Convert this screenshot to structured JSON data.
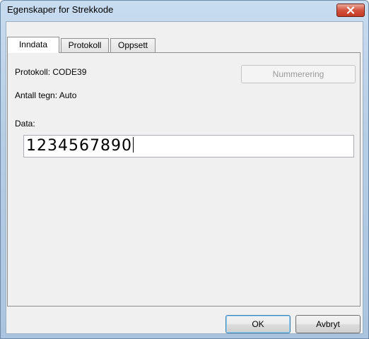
{
  "window": {
    "title": "Egenskaper for Strekkode"
  },
  "tabs": [
    {
      "label": "Inndata",
      "active": true
    },
    {
      "label": "Protokoll",
      "active": false
    },
    {
      "label": "Oppsett",
      "active": false
    }
  ],
  "inndata": {
    "protocol_text": "Protokoll: CODE39",
    "char_count_text": "Antall tegn: Auto",
    "numbering_button": "Nummerering",
    "data_label": "Data:",
    "data_value": "1234567890"
  },
  "footer": {
    "ok_label": "OK",
    "cancel_label": "Avbryt"
  },
  "colors": {
    "close_button": "#c43a23",
    "titlebar": "#b6cde6"
  },
  "icons": {
    "close": "close-icon"
  }
}
